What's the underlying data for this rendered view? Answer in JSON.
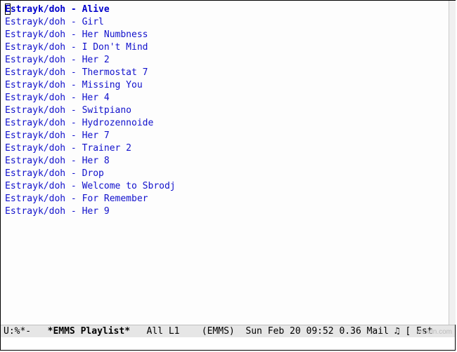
{
  "playlist": {
    "current_index": 0,
    "tracks": [
      "Estrayk/doh - Alive",
      "Estrayk/doh - Girl",
      "Estrayk/doh - Her Numbness",
      "Estrayk/doh - I Don't Mind",
      "Estrayk/doh - Her 2",
      "Estrayk/doh - Thermostat 7",
      "Estrayk/doh - Missing You",
      "Estrayk/doh - Her 4",
      "Estrayk/doh - Switpiano",
      "Estrayk/doh - Hydrozennoide",
      "Estrayk/doh - Her 7",
      "Estrayk/doh - Trainer 2",
      "Estrayk/doh - Her 8",
      "Estrayk/doh - Drop",
      "Estrayk/doh - Welcome to Sbrodj",
      "Estrayk/doh - For Remember",
      "Estrayk/doh - Her 9"
    ]
  },
  "modeline": {
    "left": "U:%*-   ",
    "buffer_name": "*EMMS Playlist*",
    "position": "   All L1   ",
    "mode": " (EMMS) ",
    "time": " Sun Feb 20 09:52 ",
    "load": "0.36 ",
    "mail": "Mail ",
    "note": "♫ ",
    "tail": "[ Est"
  },
  "minibuffer": "",
  "watermark": "wsxdn.com"
}
